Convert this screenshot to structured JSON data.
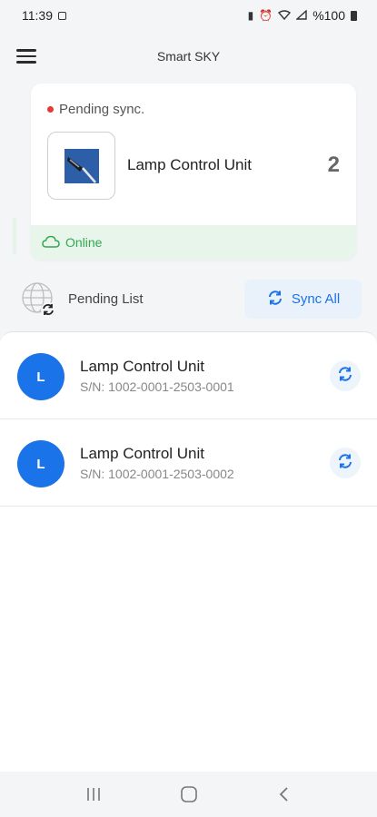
{
  "status_bar": {
    "time": "11:39",
    "battery_text": "%100",
    "icons": [
      "image-icon",
      "battery-saver-icon",
      "alarm-icon",
      "wifi-icon",
      "signal-icon",
      "battery-icon"
    ]
  },
  "header": {
    "title": "Smart SKY",
    "menu_icon": "hamburger-menu-icon"
  },
  "device_card": {
    "status_text": "Pending sync.",
    "status_color": "#e53935",
    "device_name": "Lamp Control Unit",
    "count": "2",
    "online_text": "Online",
    "online_color": "#34a853"
  },
  "pending_section": {
    "title": "Pending List",
    "sync_all_label": "Sync All"
  },
  "list": {
    "items": [
      {
        "avatar": "L",
        "title": "Lamp Control Unit",
        "serial": "S/N: 1002-0001-2503-0001"
      },
      {
        "avatar": "L",
        "title": "Lamp Control Unit",
        "serial": "S/N: 1002-0001-2503-0002"
      }
    ]
  },
  "nav": {
    "icons": [
      "recent-apps-icon",
      "home-icon",
      "back-icon"
    ]
  },
  "colors": {
    "accent": "#1a73e8",
    "accent_light": "#e9f1fb",
    "online_bg": "#e8f5ea"
  }
}
